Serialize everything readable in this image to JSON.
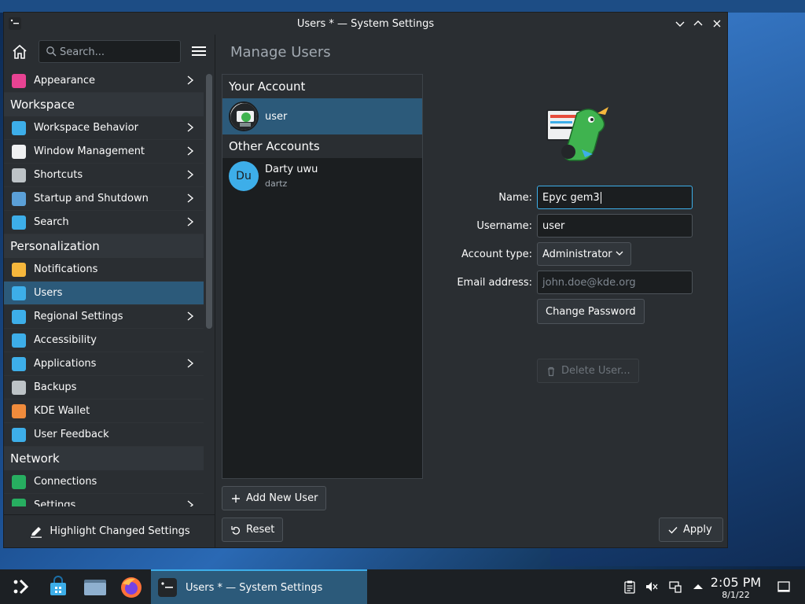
{
  "window": {
    "title": "Users * — System Settings"
  },
  "sidebar": {
    "search_placeholder": "Search...",
    "items": [
      {
        "label": "Appearance",
        "type": "item",
        "chevron": true,
        "color": "#e84393"
      },
      {
        "label": "Workspace",
        "type": "header"
      },
      {
        "label": "Workspace Behavior",
        "type": "item",
        "chevron": true,
        "color": "#3daee9"
      },
      {
        "label": "Window Management",
        "type": "item",
        "chevron": true,
        "color": "#eff0f1"
      },
      {
        "label": "Shortcuts",
        "type": "item",
        "chevron": true,
        "color": "#bdc3c7"
      },
      {
        "label": "Startup and Shutdown",
        "type": "item",
        "chevron": true,
        "color": "#5ba0d8"
      },
      {
        "label": "Search",
        "type": "item",
        "chevron": true,
        "color": "#3daee9"
      },
      {
        "label": "Personalization",
        "type": "header"
      },
      {
        "label": "Notifications",
        "type": "item",
        "chevron": false,
        "color": "#f6b73c"
      },
      {
        "label": "Users",
        "type": "item",
        "chevron": false,
        "active": true,
        "color": "#3daee9"
      },
      {
        "label": "Regional Settings",
        "type": "item",
        "chevron": true,
        "color": "#3daee9"
      },
      {
        "label": "Accessibility",
        "type": "item",
        "chevron": false,
        "color": "#3daee9"
      },
      {
        "label": "Applications",
        "type": "item",
        "chevron": true,
        "color": "#3daee9"
      },
      {
        "label": "Backups",
        "type": "item",
        "chevron": false,
        "color": "#bdc3c7"
      },
      {
        "label": "KDE Wallet",
        "type": "item",
        "chevron": false,
        "color": "#f08b3c"
      },
      {
        "label": "User Feedback",
        "type": "item",
        "chevron": false,
        "color": "#3daee9"
      },
      {
        "label": "Network",
        "type": "header"
      },
      {
        "label": "Connections",
        "type": "item",
        "chevron": false,
        "color": "#27ae60"
      },
      {
        "label": "Settings",
        "type": "item",
        "chevron": true,
        "color": "#27ae60"
      }
    ],
    "highlight_label": "Highlight Changed Settings"
  },
  "main": {
    "page_title": "Manage Users",
    "your_account_header": "Your Account",
    "current_user": {
      "name": "user"
    },
    "other_accounts_header": "Other Accounts",
    "other_users": [
      {
        "initials": "Du",
        "name": "Darty uwu",
        "username": "dartz"
      }
    ],
    "add_user_label": "Add New User",
    "form": {
      "name_label": "Name:",
      "name_value": "Epyc gem3",
      "username_label": "Username:",
      "username_value": "user",
      "account_type_label": "Account type:",
      "account_type_value": "Administrator",
      "email_label": "Email address:",
      "email_placeholder": "john.doe@kde.org",
      "change_password_label": "Change Password",
      "delete_user_label": "Delete User..."
    },
    "reset_label": "Reset",
    "apply_label": "Apply"
  },
  "taskbar": {
    "task_title": "Users * — System Settings",
    "time": "2:05 PM",
    "date": "8/1/22"
  },
  "colors": {
    "accent": "#3daee9",
    "selection": "#2c5a7a",
    "window_bg": "#2a2e32",
    "view_bg": "#1b1e20"
  }
}
